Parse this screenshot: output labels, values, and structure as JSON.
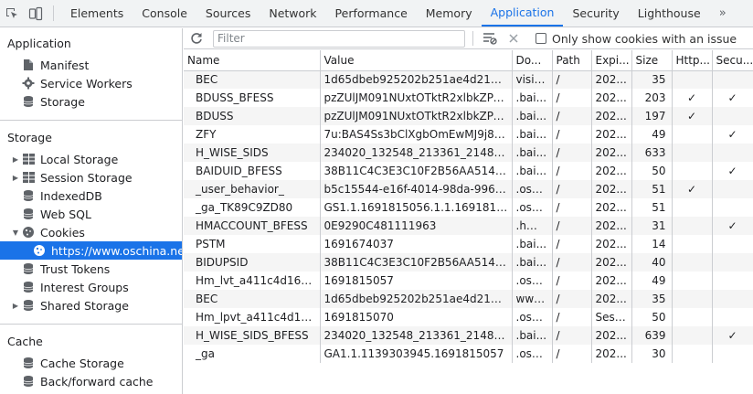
{
  "tabs": [
    "Elements",
    "Console",
    "Sources",
    "Network",
    "Performance",
    "Memory",
    "Application",
    "Security",
    "Lighthouse"
  ],
  "more_tabs": "»",
  "active_tab": "Application",
  "sidebar": {
    "application_title": "Application",
    "application_items": [
      "Manifest",
      "Service Workers",
      "Storage"
    ],
    "storage_title": "Storage",
    "storage_items": [
      "Local Storage",
      "Session Storage",
      "IndexedDB",
      "Web SQL",
      "Cookies"
    ],
    "cookie_origin": "https://www.oschina.net",
    "storage_items2": [
      "Trust Tokens",
      "Interest Groups",
      "Shared Storage"
    ],
    "cache_title": "Cache",
    "cache_items": [
      "Cache Storage",
      "Back/forward cache"
    ]
  },
  "toolbar": {
    "filter_placeholder": "Filter",
    "only_issue_label": "Only show cookies with an issue"
  },
  "table": {
    "columns": [
      "Name",
      "Value",
      "Do...",
      "Path",
      "Expi...",
      "Size",
      "Http...",
      "Secu..."
    ],
    "rows": [
      [
        "BEC",
        "1d65dbeb925202b251ae4d21a70a5...",
        "visit...",
        "/",
        "202...",
        "35",
        "",
        ""
      ],
      [
        "BDUSS_BFESS",
        "pzZUlJM091NUxtOTktR2xlbkZPeDRi...",
        ".bai...",
        "/",
        "202...",
        "203",
        "✓",
        "✓"
      ],
      [
        "BDUSS",
        "pzZUlJM091NUxtOTktR2xlbkZPeDRi...",
        ".bai...",
        "/",
        "202...",
        "197",
        "✓",
        ""
      ],
      [
        "ZFY",
        "7u:BAS4Ss3bClXgbOmEwMJ9j8F77L...",
        ".bai...",
        "/",
        "202...",
        "49",
        "",
        "✓"
      ],
      [
        "H_WISE_SIDS",
        "234020_132548_213361_214800_11...",
        ".bai...",
        "/",
        "202...",
        "633",
        "",
        ""
      ],
      [
        "BAIDUID_BFESS",
        "38B11C4C3E3C10F2B56AA5142FB9...",
        ".bai...",
        "/",
        "202...",
        "50",
        "",
        "✓"
      ],
      [
        "_user_behavior_",
        "b5c15544-e16f-4014-98da-996bd8d...",
        ".osc...",
        "/",
        "202...",
        "51",
        "✓",
        ""
      ],
      [
        "_ga_TK89C9ZD80",
        "GS1.1.1691815056.1.1.1691815070.0...",
        ".osc...",
        "/",
        "202...",
        "51",
        "",
        ""
      ],
      [
        "HMACCOUNT_BFESS",
        "0E9290C481111963",
        ".hm....",
        "/",
        "202...",
        "31",
        "",
        "✓"
      ],
      [
        "PSTM",
        "1691674037",
        ".bai...",
        "/",
        "202...",
        "14",
        "",
        ""
      ],
      [
        "BIDUPSID",
        "38B11C4C3E3C10F2B56AA5142FB9...",
        ".bai...",
        "/",
        "202...",
        "40",
        "",
        ""
      ],
      [
        "Hm_lvt_a411c4d1664d...",
        "1691815057",
        ".osc...",
        "/",
        "202...",
        "49",
        "",
        ""
      ],
      [
        "BEC",
        "1d65dbeb925202b251ae4d21a70a5...",
        "www....",
        "/",
        "202...",
        "35",
        "",
        ""
      ],
      [
        "Hm_lpvt_a411c4d1664...",
        "1691815070",
        ".osc...",
        "/",
        "Sess...",
        "50",
        "",
        ""
      ],
      [
        "H_WISE_SIDS_BFESS",
        "234020_132548_213361_214800_11...",
        ".bai...",
        "/",
        "202...",
        "639",
        "",
        "✓"
      ],
      [
        "_ga",
        "GA1.1.1139303945.1691815057",
        ".osc...",
        "/",
        "202...",
        "30",
        "",
        ""
      ]
    ]
  },
  "colors": {
    "accent": "#1a73e8",
    "border": "#cbcdd1",
    "stripe": "#f5f5f5"
  }
}
